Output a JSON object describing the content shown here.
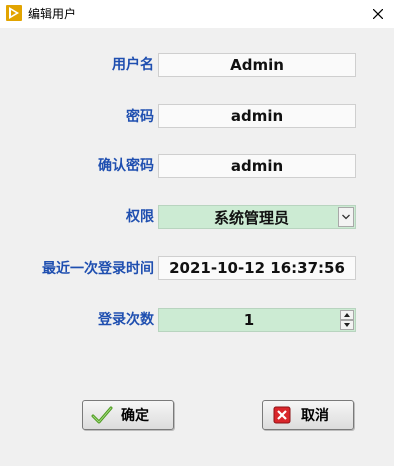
{
  "window": {
    "title": "编辑用户",
    "app_icon": "labview-run-arrow-icon",
    "close_icon": "close-icon"
  },
  "form": {
    "username": {
      "label": "用户名",
      "value": "Admin"
    },
    "password": {
      "label": "密码",
      "value": "admin"
    },
    "confirm_password": {
      "label": "确认密码",
      "value": "admin"
    },
    "permission": {
      "label": "权限",
      "value": "系统管理员",
      "icon": "chevron-down-icon"
    },
    "last_login": {
      "label": "最近一次登录时间",
      "value": "2021-10-12 16:37:56"
    },
    "login_count": {
      "label": "登录次数",
      "value": "1",
      "icons": [
        "spin-up-icon",
        "spin-down-icon"
      ]
    }
  },
  "buttons": {
    "ok": {
      "label": "确定",
      "icon": "checkmark-icon"
    },
    "cancel": {
      "label": "取消",
      "icon": "red-x-icon"
    }
  },
  "colors": {
    "label_blue": "#1f4fb0",
    "select_green": "#ccebd3",
    "cancel_red": "#d9262b",
    "ok_green": "#5aa52a"
  }
}
